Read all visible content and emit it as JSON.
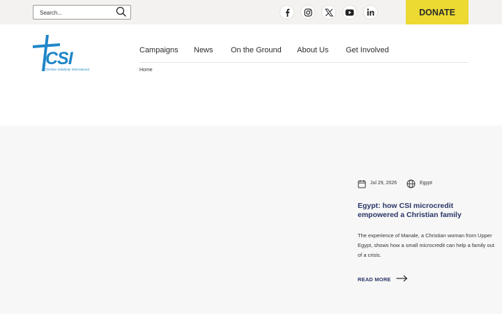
{
  "header": {
    "search": {
      "placeholder": "Search...",
      "value": ""
    },
    "social": [
      {
        "name": "facebook-icon"
      },
      {
        "name": "instagram-icon"
      },
      {
        "name": "x-icon"
      },
      {
        "name": "youtube-icon"
      },
      {
        "name": "linkedin-icon"
      }
    ],
    "donate_label": "DONATE"
  },
  "logo": {
    "mark": "CSI",
    "tagline": "Christian Solidarity International"
  },
  "nav": {
    "items": [
      {
        "label": "Campaigns"
      },
      {
        "label": "News"
      },
      {
        "label": "On the Ground"
      },
      {
        "label": "About Us"
      },
      {
        "label": "Get Involved"
      }
    ]
  },
  "breadcrumb": {
    "home": "Home"
  },
  "article": {
    "date": "Jul 29, 2026",
    "tag": "Egypt",
    "title": "Egypt: how CSI microcredit empowered a Christian family",
    "excerpt": "The experience of Manale, a Christian woman from Upper Egypt, shows how a small microcredit can help a family out of a crisis.",
    "read_more": "READ MORE"
  },
  "colors": {
    "donate": "#ecd932",
    "brand_blue": "#1f86c8",
    "title_navy": "#2a3566",
    "topbar_bg": "#f4f2f0",
    "section_bg": "#f7f7f7"
  }
}
